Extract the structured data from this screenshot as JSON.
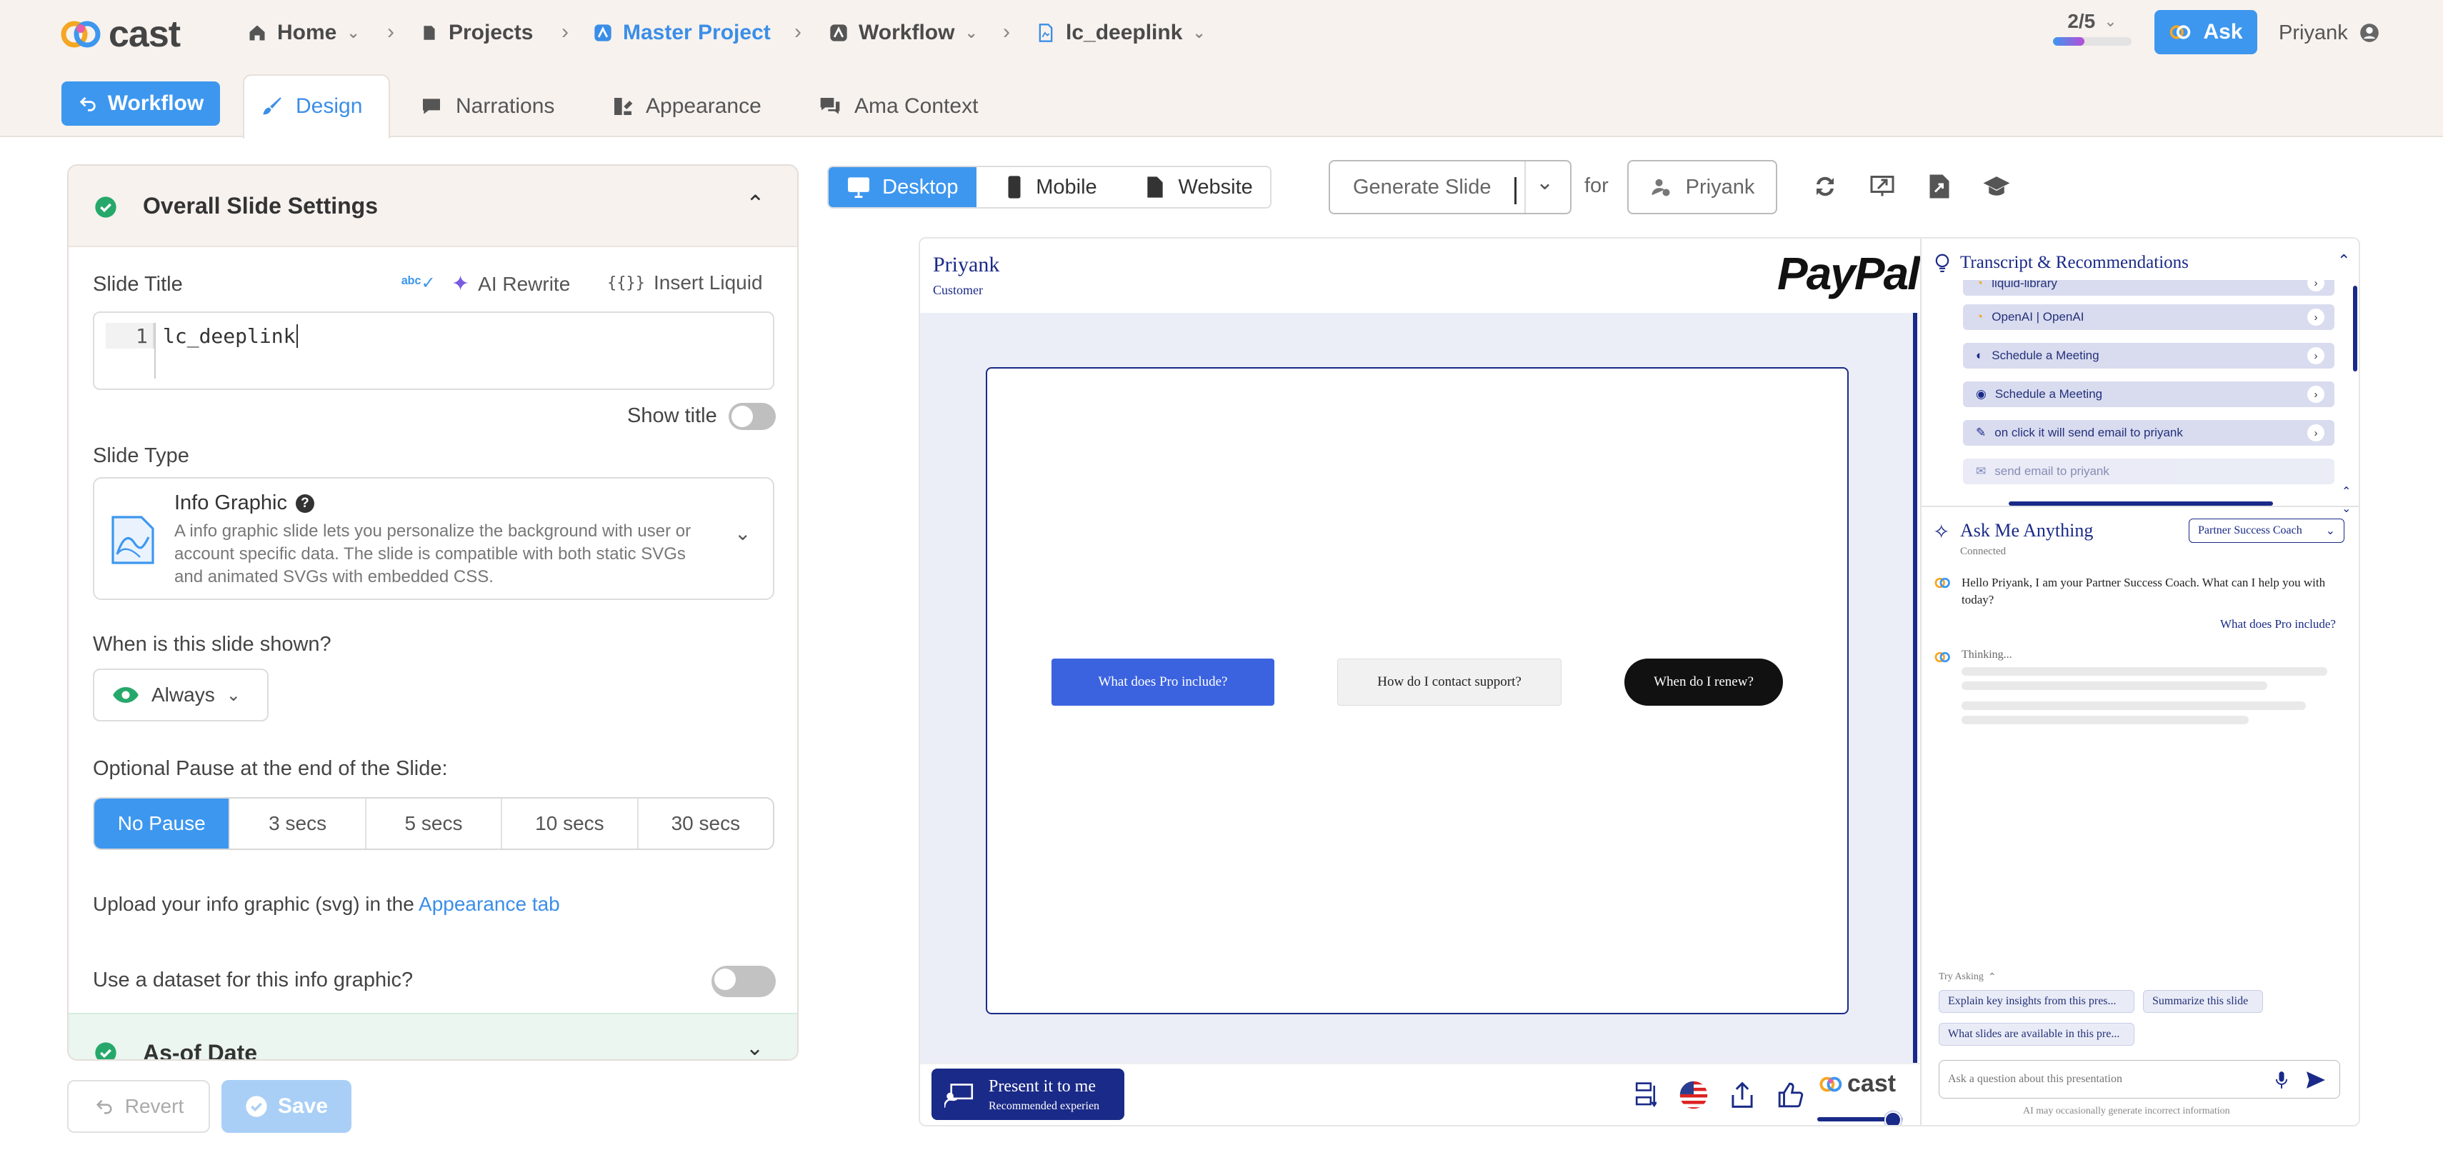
{
  "app": {
    "logo_text": "cast"
  },
  "breadcrumb": [
    {
      "label": "Home"
    },
    {
      "label": "Projects"
    },
    {
      "label": "Master Project"
    },
    {
      "label": "Workflow"
    },
    {
      "label": "lc_deeplink"
    }
  ],
  "header": {
    "progress_label": "2/5",
    "progress_fraction": 0.4,
    "ask_label": "Ask",
    "user_name": "Priyank"
  },
  "tabs": {
    "workflow_button": "Workflow",
    "items": [
      "Design",
      "Narrations",
      "Appearance",
      "Ama Context"
    ],
    "active": "Design"
  },
  "settings": {
    "section_title": "Overall Slide Settings",
    "slide_title_label": "Slide Title",
    "ai_rewrite": "AI Rewrite",
    "insert_liquid": "Insert Liquid",
    "editor_line": "1",
    "editor_value": "lc_deeplink",
    "show_title_label": "Show title",
    "slide_type_label": "Slide Type",
    "slide_type_name": "Info Graphic",
    "slide_type_desc": "A info graphic slide lets you personalize the background with user or account specific data. The slide is compatible with both static SVGs and animated SVGs with embedded CSS.",
    "shown_label": "When is this slide shown?",
    "shown_value": "Always",
    "pause_label": "Optional Pause at the end of the Slide:",
    "pause_options": [
      "No Pause",
      "3 secs",
      "5 secs",
      "10 secs",
      "30 secs"
    ],
    "upload_text": "Upload your info graphic (svg) in the",
    "upload_link": "Appearance tab",
    "dataset_label": "Use a dataset for this info graphic?",
    "as_of_date": "As-of Date"
  },
  "footer_buttons": {
    "revert": "Revert",
    "save": "Save"
  },
  "preview_toolbar": {
    "views": [
      "Desktop",
      "Mobile",
      "Website"
    ],
    "generate_label": "Generate Slide",
    "for_label": "for",
    "persona": "Priyank"
  },
  "slide": {
    "user_name": "Priyank",
    "user_role": "Customer",
    "brand": "PayPal",
    "buttons": [
      "What does Pro include?",
      "How do I contact support?",
      "When do I renew?"
    ]
  },
  "transcript": {
    "title": "Transcript & Recommendations",
    "items": [
      "liquid-library",
      "OpenAI | OpenAI",
      "Schedule a Meeting",
      "Schedule a Meeting",
      "on click it will send email to priyank",
      "send email to priyank"
    ]
  },
  "ama": {
    "title": "Ask Me Anything",
    "status": "Connected",
    "coach_select": "Partner Success Coach",
    "bot_message": "Hello Priyank, I am your Partner Success Coach. What can I help you with today?",
    "user_message": "What does Pro include?",
    "thinking": "Thinking...",
    "try_asking": "Try Asking",
    "suggestions": [
      "Explain key insights from this pres...",
      "Summarize this slide",
      "What slides are available in this pre..."
    ],
    "input_placeholder": "Ask a question about this presentation",
    "disclaimer": "AI may occasionally generate incorrect information"
  },
  "present": {
    "title": "Present it to me",
    "subtitle": "Recommended experien"
  },
  "bottom_logo": "cast",
  "colors": {
    "accent": "#3d97ef",
    "navy": "#1a2a88",
    "slide_blue": "#3b63e0",
    "success": "#27a86b"
  }
}
